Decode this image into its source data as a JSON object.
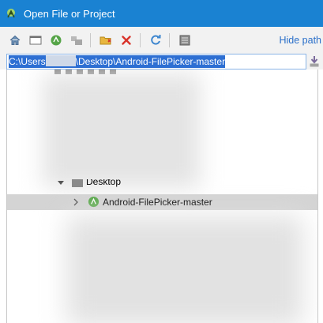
{
  "window": {
    "title": "Open File or Project"
  },
  "toolbar": {
    "buttons": [
      "home-icon",
      "desktop-icon",
      "project-icon",
      "module-icon",
      "new-folder-icon",
      "delete-icon",
      "refresh-icon",
      "show-hidden-icon"
    ],
    "hide_path_label": "Hide path"
  },
  "path": {
    "prefix": "C:\\Users",
    "suffix": "\\Desktop\\Android-FilePicker-master"
  },
  "tree": {
    "desktop_label": "Desktop",
    "selected_label": "Android-FilePicker-master"
  },
  "colors": {
    "titlebar": "#1a82d2",
    "selection": "#2d6fd3",
    "row_selected": "#d4d4d4",
    "link": "#2a6fc9"
  }
}
